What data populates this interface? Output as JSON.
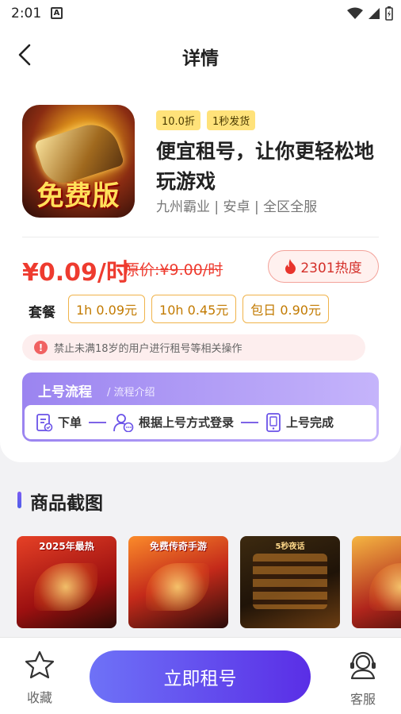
{
  "status": {
    "time": "2:01",
    "notification_letter": "A"
  },
  "nav": {
    "title": "详情"
  },
  "app": {
    "icon_text": "免费版",
    "tags": [
      "10.0折",
      "1秒发货"
    ],
    "name": "便宜租号，让你更轻松地玩游戏",
    "meta": "九州霸业 | 安卓 | 全区全服"
  },
  "pricing": {
    "price": "¥0.09/时",
    "original_price": "原价:¥9.00/时",
    "heat": "2301热度"
  },
  "plans": {
    "label": "套餐",
    "options": [
      "1h 0.09元",
      "10h 0.45元",
      "包日 0.90元"
    ]
  },
  "warning": {
    "text": "禁止未满18岁的用户进行租号等相关操作"
  },
  "flow": {
    "title": "上号流程",
    "subtitle": "/ 流程介绍",
    "steps": [
      "下单",
      "根据上号方式登录",
      "上号完成"
    ]
  },
  "screenshots": {
    "title": "商品截图",
    "captions": [
      "2025年最热",
      "免费传奇手游",
      "5秒夜话",
      ""
    ]
  },
  "bottom": {
    "favorite_label": "收藏",
    "rent_label": "立即租号",
    "service_label": "客服"
  },
  "colors": {
    "accent": "#6e4cf0",
    "price": "#ee3b2f",
    "tag_bg": "#ffe27a",
    "plan_border": "#f0b34a"
  }
}
